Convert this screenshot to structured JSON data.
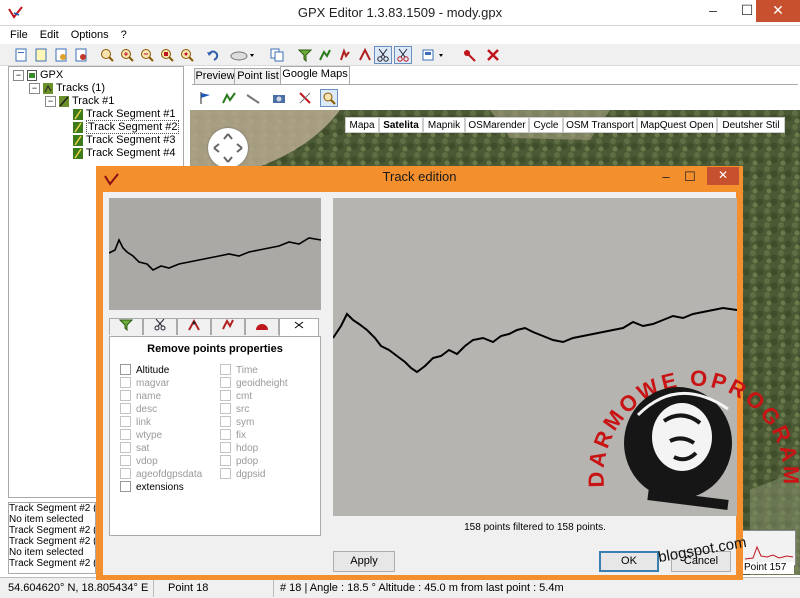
{
  "app": {
    "title": "GPX Editor 1.3.83.1509 - mody.gpx",
    "window_controls": {
      "minimize": "–",
      "maximize": "☐",
      "close": "✕"
    }
  },
  "menu": [
    "File",
    "Edit",
    "Options",
    "?"
  ],
  "toolbar": {
    "buttons": [
      "new-icon",
      "open-icon",
      "merge-icon",
      "save-icon",
      "zoom-in-icon",
      "zoom-in-alt-icon",
      "zoom-out-icon",
      "zoom-reset-icon",
      "zoom-fit-icon",
      "undo-icon",
      "cloud-dropdown-icon",
      "copy-icon",
      "filter-icon",
      "split-track-icon",
      "terrain-icon",
      "join-icon",
      "cut-icon",
      "export-dropdown-icon",
      "remove-points-icon",
      "delete-icon"
    ]
  },
  "tree": {
    "root": "GPX",
    "tracks": "Tracks (1)",
    "track": "Track #1",
    "segments": [
      "Track Segment #1",
      "Track Segment #2",
      "Track Segment #3",
      "Track Segment #4"
    ]
  },
  "log": [
    "Track Segment #2 (1",
    "No item selected",
    "Track Segment #2 (1",
    "Track Segment #2 (1",
    "No item selected",
    "Track Segment #2 (1"
  ],
  "tabs": [
    "Preview",
    "Point list",
    "Google Maps"
  ],
  "map": {
    "types": [
      "Mapa",
      "Satelita",
      "Mapnik",
      "OSMarender",
      "Cycle",
      "OSM Transport",
      "MapQuest Open",
      "Deutsher Stil"
    ],
    "active_type": "Satelita",
    "point_label": "Point 157"
  },
  "status": {
    "coords": "54.604620° N, 18.805434° E",
    "point": "Point 18",
    "detail": "# 18 | Angle : 18.5 ° Altitude : 45.0 m from last point : 5.4m"
  },
  "dialog": {
    "title": "Track edition",
    "panel_title": "Remove points properties",
    "left_options": [
      {
        "label": "Altitude",
        "enabled": true
      },
      {
        "label": "magvar",
        "enabled": false
      },
      {
        "label": "name",
        "enabled": false
      },
      {
        "label": "desc",
        "enabled": false
      },
      {
        "label": "link",
        "enabled": false
      },
      {
        "label": "wtype",
        "enabled": false
      },
      {
        "label": "sat",
        "enabled": false
      },
      {
        "label": "vdop",
        "enabled": false
      },
      {
        "label": "ageofdgpsdata",
        "enabled": false
      },
      {
        "label": "extensions",
        "enabled": true
      }
    ],
    "right_options": [
      {
        "label": "Time",
        "enabled": false
      },
      {
        "label": "geoidheight",
        "enabled": false
      },
      {
        "label": "cmt",
        "enabled": false
      },
      {
        "label": "src",
        "enabled": false
      },
      {
        "label": "sym",
        "enabled": false
      },
      {
        "label": "fix",
        "enabled": false
      },
      {
        "label": "hdop",
        "enabled": false
      },
      {
        "label": "pdop",
        "enabled": false
      },
      {
        "label": "dgpsid",
        "enabled": false
      }
    ],
    "status_text": "158 points filtered to 158 points.",
    "apply": "Apply",
    "ok": "OK",
    "cancel": "Cancel"
  },
  "watermark": {
    "arc_text": "DARMOWE OPROGRAMOWANIE",
    "url": "blogspot.com"
  }
}
